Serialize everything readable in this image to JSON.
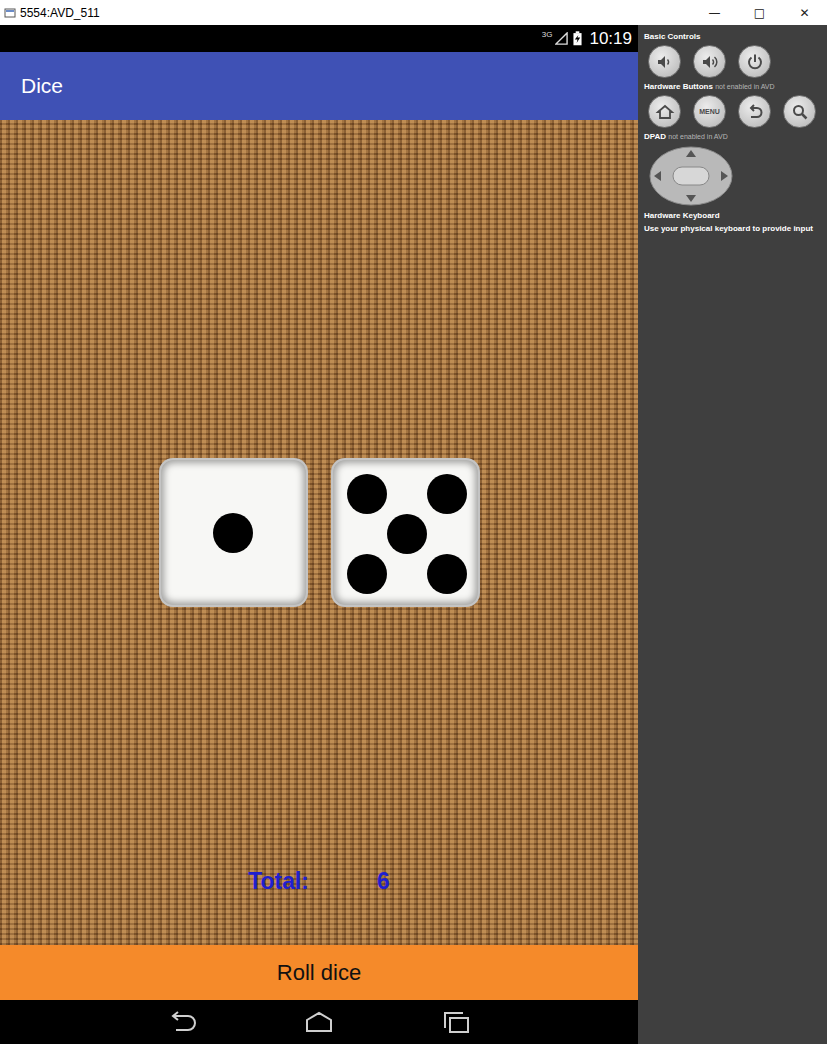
{
  "window": {
    "title": "5554:AVD_511",
    "controls": [
      "—",
      "□",
      "✕"
    ]
  },
  "status_bar": {
    "network": "3G",
    "time": "10:19"
  },
  "app_bar": {
    "title": "Dice"
  },
  "dice": [
    {
      "value": 1
    },
    {
      "value": 5
    }
  ],
  "total": {
    "label": "Total:",
    "value": "6"
  },
  "roll_button": {
    "label": "Roll dice"
  },
  "side_panel": {
    "sections": [
      {
        "title": "Basic Controls",
        "buttons": [
          {
            "kind": "volume-down"
          },
          {
            "kind": "volume-up"
          },
          {
            "kind": "power"
          }
        ]
      },
      {
        "title": "Hardware Buttons",
        "note": "not enabled in AVD",
        "buttons": [
          {
            "kind": "home"
          },
          {
            "kind": "text",
            "label": "MENU"
          },
          {
            "kind": "back"
          },
          {
            "kind": "search"
          }
        ]
      },
      {
        "title": "DPAD",
        "note": "not enabled in AVD",
        "buttons": [
          {
            "kind": "dpad"
          }
        ]
      }
    ],
    "keyboard": {
      "title": "Hardware Keyboard",
      "hint": "Use your physical keyboard to provide input"
    }
  }
}
